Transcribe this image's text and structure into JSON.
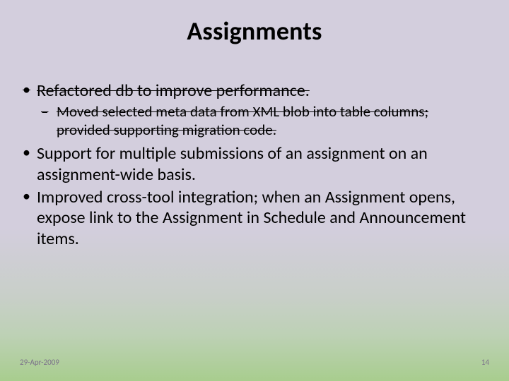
{
  "slide": {
    "title": "Assignments",
    "bullets": {
      "b1": "Refactored db to improve performance.",
      "b1_sub": "Moved selected meta data from XML blob into table columns; provided supporting migration code.",
      "b2": "Support for multiple submissions of an assignment on an assignment-wide basis.",
      "b3": "Improved cross-tool integration; when an Assignment opens, expose link to the Assignment in Schedule and Announcement items."
    },
    "footer": {
      "date": "29-Apr-2009",
      "page": "14"
    }
  }
}
